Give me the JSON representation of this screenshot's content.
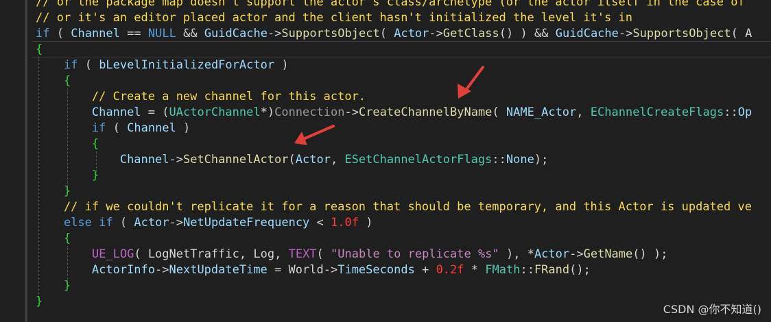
{
  "code_lines": [
    "// or the package map doesn't support the actor's class/archetype (or the actor itself in the case of",
    "// or it's an editor placed actor and the client hasn't initialized the level it's in",
    "if ( Channel == NULL && GuidCache->SupportsObject( Actor->GetClass() ) && GuidCache->SupportsObject( A",
    "{",
    "    if ( bLevelInitializedForActor )",
    "    {",
    "        // Create a new channel for this actor.",
    "        Channel = (UActorChannel*)Connection->CreateChannelByName( NAME_Actor, EChannelCreateFlags::Op",
    "        if ( Channel )",
    "        {",
    "            Channel->SetChannelActor(Actor, ESetChannelActorFlags::None);",
    "        }",
    "    }",
    "    // if we couldn't replicate it for a reason that should be temporary, and this Actor is updated ve",
    "    else if ( Actor->NetUpdateFrequency < 1.0f )",
    "    {",
    "        UE_LOG( LogNetTraffic, Log, TEXT( \"Unable to replicate %s\" ), *Actor->GetName() );",
    "        ActorInfo->NextUpdateTime = World->TimeSeconds + 0.2f * FMath::FRand();",
    "    }",
    "}"
  ],
  "colors": {
    "background": "#1f1f1f",
    "comment": "#f7d94c",
    "keyword": "#569cd6",
    "function": "#dcdcaa",
    "number": "#ff3a3a",
    "string": "#c586c0",
    "brace": "#2fd42f",
    "arrow": "#e0403a"
  },
  "watermark": "CSDN @你不知道()"
}
